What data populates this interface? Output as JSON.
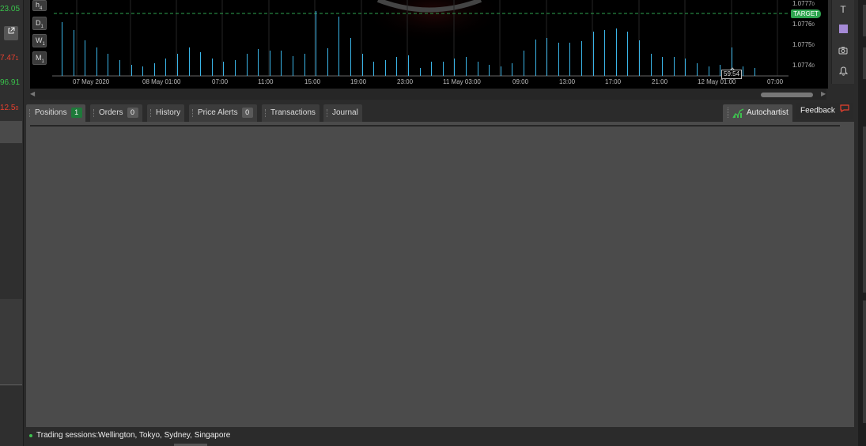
{
  "left_panel": {
    "prices": [
      {
        "text": "23.05",
        "color": "green"
      },
      {
        "text": "7.47",
        "sub": "1",
        "color": "red"
      },
      {
        "text": "96.91",
        "color": "green"
      },
      {
        "text": "12.5",
        "sub": "0",
        "color": "red"
      }
    ],
    "external_link_icon": "external-link-icon"
  },
  "chart": {
    "timeframes": [
      {
        "letter": "h",
        "sub": "4"
      },
      {
        "letter": "D",
        "sub": "1"
      },
      {
        "letter": "W",
        "sub": "1"
      },
      {
        "letter": "M",
        "sub": "1"
      }
    ],
    "price_labels": [
      {
        "main": "1.0777",
        "sub": "0"
      },
      {
        "main": "1.0776",
        "sub": "0"
      },
      {
        "main": "1.0775",
        "sub": "0"
      },
      {
        "main": "1.0774",
        "sub": "0"
      }
    ],
    "target_label": "TARGET",
    "time_labels": [
      "07 May 2020",
      "08 May 01:00",
      "07:00",
      "11:00",
      "15:00",
      "19:00",
      "23:00",
      "11 May 03:00",
      "09:00",
      "13:00",
      "17:00",
      "21:00",
      "12 May 01:00",
      "07:00"
    ],
    "countdown": "59:54",
    "volume_bars": [
      68,
      58,
      45,
      36,
      28,
      20,
      14,
      12,
      16,
      22,
      28,
      36,
      30,
      22,
      18,
      20,
      28,
      34,
      32,
      32,
      25,
      28,
      82,
      35,
      75,
      48,
      28,
      18,
      20,
      24,
      26,
      10,
      18,
      18,
      22,
      24,
      18,
      14,
      12,
      16,
      32,
      46,
      48,
      42,
      42,
      44,
      56,
      58,
      60,
      56,
      45,
      28,
      24,
      24,
      22,
      16,
      12,
      14,
      36,
      12,
      10
    ]
  },
  "right_toolbar": {
    "text_tool": "T",
    "icons": [
      "text-icon",
      "color-swatch-icon",
      "camera-icon",
      "bell-icon"
    ],
    "swatch_color": "#a58ad6"
  },
  "tabs": [
    {
      "label": "Positions",
      "badge": "1",
      "badge_color": "green"
    },
    {
      "label": "Orders",
      "badge": "0"
    },
    {
      "label": "History"
    },
    {
      "label": "Price Alerts",
      "badge": "0"
    },
    {
      "label": "Transactions"
    },
    {
      "label": "Journal"
    }
  ],
  "autochartist": {
    "label": "Autochartist",
    "icon": "autochartist-icon"
  },
  "feedback": {
    "label": "Feedback",
    "icon": "speech-bubble-icon"
  },
  "status": {
    "text": "Trading sessions:Wellington, Tokyo, Sydney, Singapore",
    "dot_color": "#3ec14f"
  }
}
